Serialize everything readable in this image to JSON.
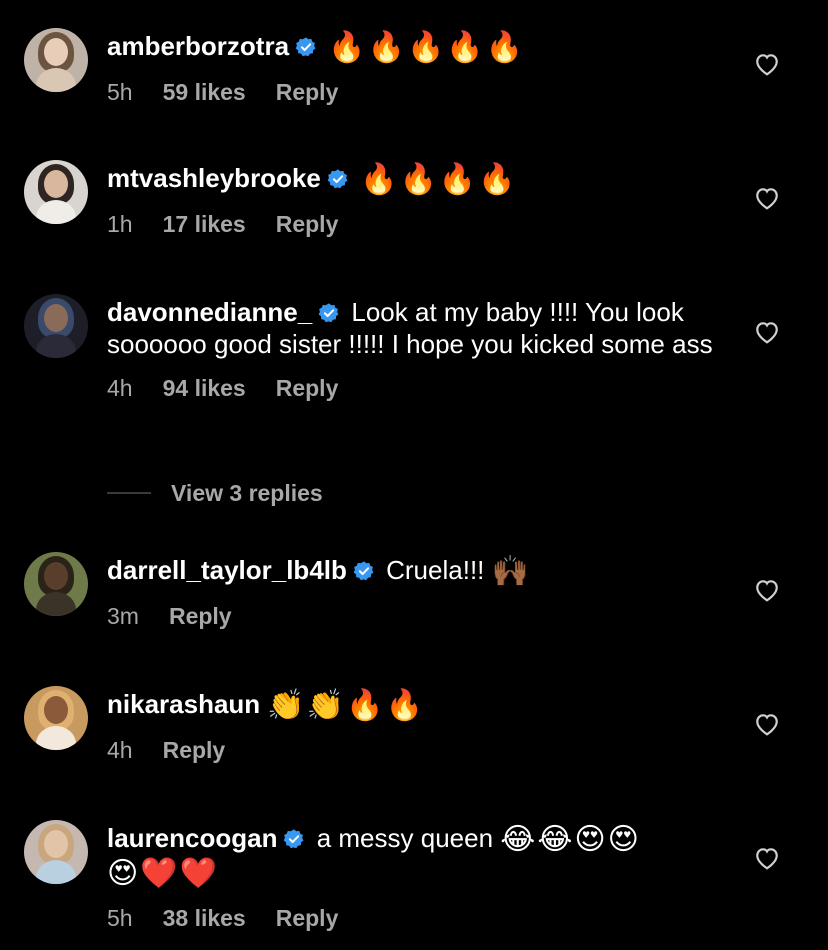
{
  "colors": {
    "background": "#000000",
    "text": "#ffffff",
    "muted": "#a8a8a8",
    "verified": "#3897f0"
  },
  "comments": [
    {
      "username": "amberborzotra",
      "verified": true,
      "text": "",
      "emoji": "🔥🔥🔥🔥🔥",
      "emoji_line2": "",
      "time": "5h",
      "likes": "59 likes",
      "reply": "Reply",
      "avatar": {
        "bg": "#bfb3a8",
        "hair": "#6b5440",
        "face": "#e8cdb8",
        "torso": "#d9c7b4"
      }
    },
    {
      "username": "mtvashleybrooke",
      "verified": true,
      "text": "",
      "emoji": "🔥🔥🔥🔥",
      "emoji_line2": "",
      "time": "1h",
      "likes": "17 likes",
      "reply": "Reply",
      "avatar": {
        "bg": "#d8d4d0",
        "hair": "#2e2420",
        "face": "#d9b79f",
        "torso": "#f0ece8"
      }
    },
    {
      "username": "davonnedianne_",
      "verified": true,
      "text": "Look at my baby !!!! You look soooooo good sister !!!!! I hope you kicked some ass",
      "emoji": "",
      "emoji_line2": "",
      "time": "4h",
      "likes": "94 likes",
      "reply": "Reply",
      "avatar": {
        "bg": "#1e1e28",
        "hair": "#3a4a6a",
        "face": "#8a6a58",
        "torso": "#2a2a38"
      }
    },
    {
      "username": "darrell_taylor_lb4lb",
      "verified": true,
      "text": "Cruela!!!",
      "emoji": "🙌🏾",
      "emoji_line2": "",
      "time": "3m",
      "likes": "",
      "reply": "Reply",
      "avatar": {
        "bg": "#6e7a4a",
        "hair": "#2a2418",
        "face": "#5a3e2c",
        "torso": "#3a3428"
      }
    },
    {
      "username": "nikarashaun",
      "verified": false,
      "text": "",
      "emoji": "👏👏🔥🔥",
      "emoji_line2": "",
      "time": "4h",
      "likes": "",
      "reply": "Reply",
      "avatar": {
        "bg": "#c99a60",
        "hair": "#e0b070",
        "face": "#8a5a3a",
        "torso": "#f2e8dc"
      }
    },
    {
      "username": "laurencoogan",
      "verified": true,
      "text": "a messy queen",
      "emoji": "😂😂😍😍",
      "emoji_line2": "😍❤️❤️",
      "time": "5h",
      "likes": "38 likes",
      "reply": "Reply",
      "avatar": {
        "bg": "#c4b8b0",
        "hair": "#c9a67e",
        "face": "#e2c4a8",
        "torso": "#b8d0e0"
      }
    }
  ],
  "view_replies": "View 3 replies",
  "icons": {
    "heart": "heart-outline-icon",
    "verified": "verified-badge-icon"
  }
}
